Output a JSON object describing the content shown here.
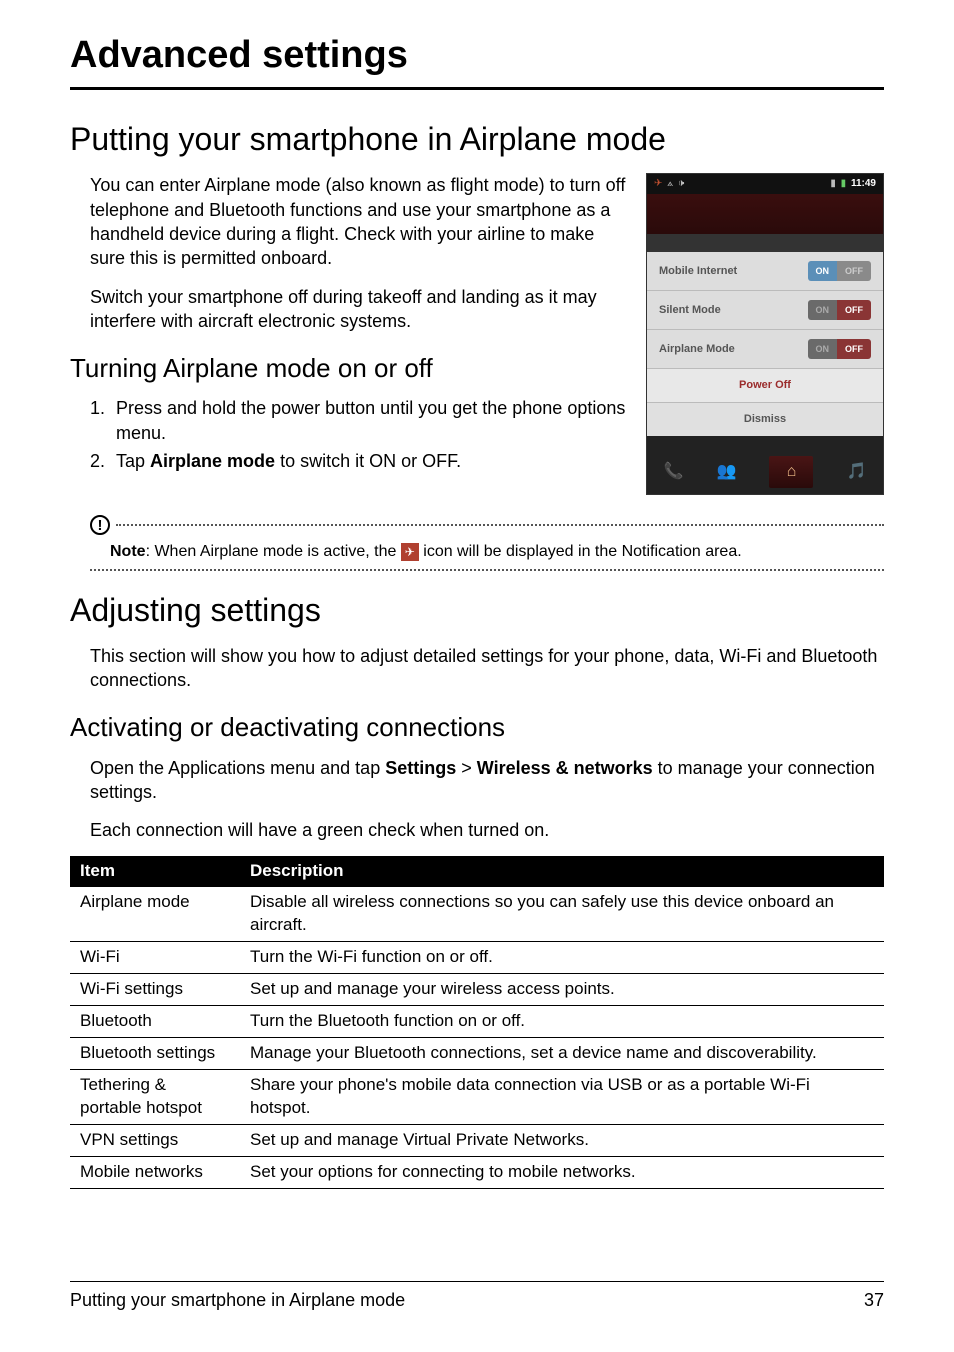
{
  "chapter_title": "Advanced settings",
  "h1": "Putting your smartphone in Airplane mode",
  "p1": "You can enter Airplane mode (also known as flight mode) to turn off telephone and Bluetooth functions and use your smartphone as a handheld device during a flight. Check with your airline to make sure this is permitted onboard.",
  "p2": "Switch your smartphone off during takeoff and landing as it may interfere with aircraft electronic systems.",
  "h2": "Turning Airplane mode on or off",
  "steps": [
    "Press and hold the power button until you get the phone options menu.",
    "Tap Airplane mode to switch it ON or OFF."
  ],
  "step2_prefix": "Tap ",
  "step2_bold": "Airplane mode",
  "step2_suffix": " to switch it ON or OFF.",
  "note_label": "Note",
  "note_pre": ": When Airplane mode is active, the ",
  "note_post": " icon will be displayed in the Notification area.",
  "h3": "Adjusting settings",
  "p3": "This section will show you how to adjust detailed settings for your phone, data, Wi-Fi and Bluetooth connections.",
  "h4": "Activating or deactivating connections",
  "p4_pre": "Open the Applications menu and tap ",
  "p4_b1": "Settings",
  "p4_gt": " > ",
  "p4_b2": "Wireless & networks",
  "p4_post": " to manage your connection settings.",
  "p5": "Each connection will have a green check when turned on.",
  "table": {
    "head_item": "Item",
    "head_desc": "Description",
    "rows": [
      {
        "item": "Airplane mode",
        "desc": "Disable all wireless connections so you can safely use this device onboard an aircraft."
      },
      {
        "item": "Wi-Fi",
        "desc": "Turn the Wi-Fi function on or off."
      },
      {
        "item": "Wi-Fi settings",
        "desc": "Set up and manage your wireless access points."
      },
      {
        "item": "Bluetooth",
        "desc": "Turn the Bluetooth function on or off."
      },
      {
        "item": "Bluetooth settings",
        "desc": "Manage your Bluetooth connections, set a device name and discoverability."
      },
      {
        "item": "Tethering & portable hotspot",
        "desc": "Share your phone's mobile data connection via USB or as a portable Wi-Fi hotspot."
      },
      {
        "item": "VPN settings",
        "desc": "Set up and manage Virtual Private Networks."
      },
      {
        "item": "Mobile networks",
        "desc": "Set your options for connecting to mobile networks."
      }
    ]
  },
  "phone": {
    "time": "11:49",
    "row1": "Mobile Internet",
    "row2": "Silent Mode",
    "row3": "Airplane Mode",
    "power_off": "Power Off",
    "dismiss": "Dismiss",
    "on": "ON",
    "off": "OFF"
  },
  "footer_left": "Putting your smartphone in Airplane mode",
  "footer_right": "37"
}
